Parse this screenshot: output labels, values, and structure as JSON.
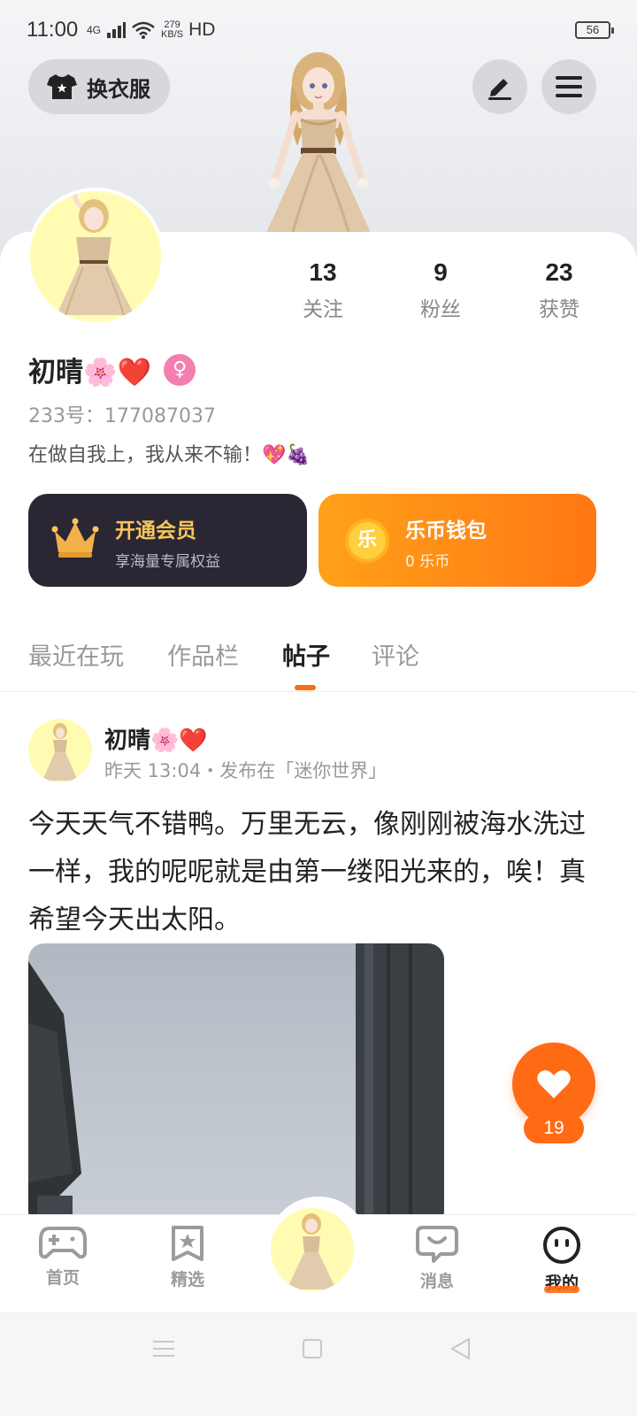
{
  "status_bar": {
    "time": "11:00",
    "network": "4G",
    "speed_value": "279",
    "speed_unit": "KB/S",
    "hd": "HD",
    "battery": "56"
  },
  "header": {
    "wardrobe_label": "换衣服"
  },
  "profile": {
    "name": "初晴🌸❤️",
    "uid": "233号：177087037",
    "bio": "在做自我上，我从来不输！💖🍇",
    "stats": [
      {
        "value": "13",
        "label": "关注"
      },
      {
        "value": "9",
        "label": "粉丝"
      },
      {
        "value": "23",
        "label": "获赞"
      }
    ]
  },
  "vip": {
    "title": "开通会员",
    "subtitle": "享海量专属权益"
  },
  "wallet": {
    "title": "乐币钱包",
    "subtitle": "0 乐币",
    "coin_char": "乐"
  },
  "tabs": [
    {
      "label": "最近在玩",
      "active": false
    },
    {
      "label": "作品栏",
      "active": false
    },
    {
      "label": "帖子",
      "active": true
    },
    {
      "label": "评论",
      "active": false
    }
  ],
  "post": {
    "author": "初晴🌸❤️",
    "meta": "昨天 13:04・发布在「迷你世界」",
    "text": "今天天气不错鸭。万里无云，像刚刚被海水洗过一样，我的呢呢就是由第一缕阳光来的，唉！真希望今天出太阳。",
    "like_count": "19"
  },
  "bottom_nav": [
    {
      "label": "首页",
      "icon": "gamepad-icon",
      "active": false
    },
    {
      "label": "精选",
      "icon": "star-bookmark-icon",
      "active": false
    },
    {
      "label": "消息",
      "icon": "chat-bubble-icon",
      "active": false
    },
    {
      "label": "我的",
      "icon": "face-icon",
      "active": true
    }
  ],
  "colors": {
    "accent": "#ff6a14",
    "vip_bg": "#2a2634",
    "vip_gold": "#f7c65b",
    "gender_pink": "#f57eb0"
  }
}
